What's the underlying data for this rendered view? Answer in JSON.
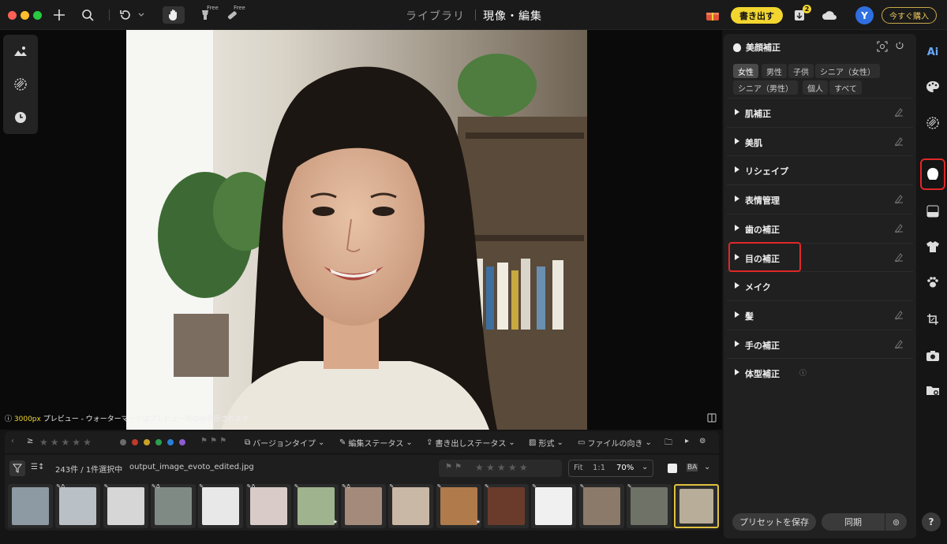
{
  "topbar": {
    "nav_library": "ライブラリ",
    "nav_develop": "現像・編集",
    "free_label": "Free",
    "export_label": "書き出す",
    "notification_count": "2",
    "avatar_letter": "Y",
    "buy_label": "今すぐ購入"
  },
  "canvas": {
    "preview_px": "3000px",
    "preview_text": " プレビュー - ウォーターマークはプレビュー時のみ表示されます"
  },
  "filterbar": {
    "ge_symbol": "≥",
    "version_type": "バージョンタイプ",
    "edit_status": "編集ステータス",
    "export_status": "書き出しステータス",
    "format": "形式",
    "orientation": "ファイルの向き",
    "color_labels": [
      "#6b6b6b",
      "#c0392b",
      "#c9a227",
      "#2e9e4f",
      "#2a7fd4",
      "#8e5bd0"
    ]
  },
  "infobar": {
    "count_text": "243件 / 1件選択中",
    "filename": "output_image_evoto_edited.jpg",
    "fit": "Fit",
    "one_to_one": "1:1",
    "zoom": "70%",
    "ba": "BA"
  },
  "filmstrip": {
    "thumbs": [
      {
        "color": "#8d9aa3",
        "tag": ""
      },
      {
        "color": "#b9c1c7",
        "tag": "✎♁"
      },
      {
        "color": "#d6d6d6",
        "tag": "✎"
      },
      {
        "color": "#7f8a85",
        "tag": "✎♁"
      },
      {
        "color": "#e8e8e8",
        "tag": "✎"
      },
      {
        "color": "#d9ccc8",
        "tag": "✎♁"
      },
      {
        "color": "#9fb48e",
        "tag": "✎"
      },
      {
        "color": "#a38a7a",
        "tag": "✎♁"
      },
      {
        "color": "#c9b8a6",
        "tag": "✎"
      },
      {
        "color": "#b07a4a",
        "tag": "✎"
      },
      {
        "color": "#6a3b2a",
        "tag": "✎"
      },
      {
        "color": "#f0f0f0",
        "tag": "✎"
      },
      {
        "color": "#8b7a6a",
        "tag": "✎"
      },
      {
        "color": "#6f7367",
        "tag": "✎"
      },
      {
        "color": "#b8ad98",
        "tag": ""
      }
    ],
    "star_mark": "★"
  },
  "rpanel": {
    "title": "美顔補正",
    "chips": [
      "女性",
      "男性",
      "子供",
      "シニア（女性）",
      "シニア（男性）",
      "個人",
      "すべて"
    ],
    "sections": [
      "肌補正",
      "美肌",
      "リシェイプ",
      "表情管理",
      "歯の補正",
      "目の補正",
      "メイク",
      "髪",
      "手の補正",
      "体型補正"
    ],
    "preset_label": "プリセットを保存",
    "sync_label": "同期"
  },
  "rsidebar": {
    "ai_label": "Ai",
    "help": "?"
  }
}
